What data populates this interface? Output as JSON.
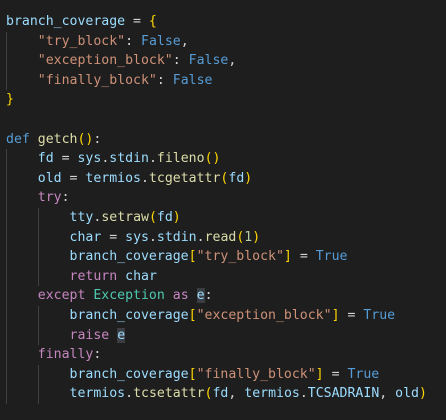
{
  "colors": {
    "background": "#1e1e1e",
    "variable": "#9cdcfe",
    "keyword": "#c586c0",
    "def_keyword": "#569cd6",
    "function": "#dcdcaa",
    "string": "#ce9178",
    "boolean": "#569cd6",
    "number": "#b5cea8",
    "class": "#4ec9b0",
    "bracket_level1": "#ffd700",
    "bracket_level2": "#da70d6"
  },
  "lines": [
    [
      [
        "branch_coverage",
        "var"
      ],
      [
        " = ",
        "op"
      ],
      [
        "{",
        "br1"
      ]
    ],
    [
      [
        "    ",
        "plain"
      ],
      [
        "\"try_block\"",
        "str"
      ],
      [
        ": ",
        "op"
      ],
      [
        "False",
        "bool"
      ],
      [
        ",",
        "op"
      ]
    ],
    [
      [
        "    ",
        "plain"
      ],
      [
        "\"exception_block\"",
        "str"
      ],
      [
        ": ",
        "op"
      ],
      [
        "False",
        "bool"
      ],
      [
        ",",
        "op"
      ]
    ],
    [
      [
        "    ",
        "plain"
      ],
      [
        "\"finally_block\"",
        "str"
      ],
      [
        ": ",
        "op"
      ],
      [
        "False",
        "bool"
      ]
    ],
    [
      [
        "}",
        "br1"
      ]
    ],
    [],
    [
      [
        "def",
        "def"
      ],
      [
        " ",
        "plain"
      ],
      [
        "getch",
        "fn"
      ],
      [
        "()",
        "br1"
      ],
      [
        ":",
        "op"
      ]
    ],
    [
      [
        "    ",
        "plain"
      ],
      [
        "fd",
        "var"
      ],
      [
        " = ",
        "op"
      ],
      [
        "sys",
        "var"
      ],
      [
        ".",
        "op"
      ],
      [
        "stdin",
        "var"
      ],
      [
        ".",
        "op"
      ],
      [
        "fileno",
        "fn"
      ],
      [
        "()",
        "br1"
      ]
    ],
    [
      [
        "    ",
        "plain"
      ],
      [
        "old",
        "var"
      ],
      [
        " = ",
        "op"
      ],
      [
        "termios",
        "var"
      ],
      [
        ".",
        "op"
      ],
      [
        "tcgetattr",
        "fn"
      ],
      [
        "(",
        "br1"
      ],
      [
        "fd",
        "var"
      ],
      [
        ")",
        "br1"
      ]
    ],
    [
      [
        "    ",
        "plain"
      ],
      [
        "try",
        "kw"
      ],
      [
        ":",
        "op"
      ]
    ],
    [
      [
        "        ",
        "plain"
      ],
      [
        "tty",
        "var"
      ],
      [
        ".",
        "op"
      ],
      [
        "setraw",
        "fn"
      ],
      [
        "(",
        "br1"
      ],
      [
        "fd",
        "var"
      ],
      [
        ")",
        "br1"
      ]
    ],
    [
      [
        "        ",
        "plain"
      ],
      [
        "char",
        "var"
      ],
      [
        " = ",
        "op"
      ],
      [
        "sys",
        "var"
      ],
      [
        ".",
        "op"
      ],
      [
        "stdin",
        "var"
      ],
      [
        ".",
        "op"
      ],
      [
        "read",
        "fn"
      ],
      [
        "(",
        "br1"
      ],
      [
        "1",
        "num"
      ],
      [
        ")",
        "br1"
      ]
    ],
    [
      [
        "        ",
        "plain"
      ],
      [
        "branch_coverage",
        "var"
      ],
      [
        "[",
        "br1"
      ],
      [
        "\"try_block\"",
        "str"
      ],
      [
        "]",
        "br1"
      ],
      [
        " = ",
        "op"
      ],
      [
        "True",
        "bool"
      ]
    ],
    [
      [
        "        ",
        "plain"
      ],
      [
        "return",
        "kw"
      ],
      [
        " ",
        "plain"
      ],
      [
        "char",
        "var"
      ]
    ],
    [
      [
        "    ",
        "plain"
      ],
      [
        "except",
        "kw"
      ],
      [
        " ",
        "plain"
      ],
      [
        "Exception",
        "cls"
      ],
      [
        " ",
        "plain"
      ],
      [
        "as",
        "kw"
      ],
      [
        " ",
        "plain"
      ],
      [
        "e",
        "var hl"
      ],
      [
        ":",
        "op"
      ]
    ],
    [
      [
        "        ",
        "plain"
      ],
      [
        "branch_coverage",
        "var"
      ],
      [
        "[",
        "br1"
      ],
      [
        "\"exception_block\"",
        "str"
      ],
      [
        "]",
        "br1"
      ],
      [
        " = ",
        "op"
      ],
      [
        "True",
        "bool"
      ]
    ],
    [
      [
        "        ",
        "plain"
      ],
      [
        "raise",
        "kw"
      ],
      [
        " ",
        "plain"
      ],
      [
        "e",
        "var hl"
      ]
    ],
    [
      [
        "    ",
        "plain"
      ],
      [
        "finally",
        "kw"
      ],
      [
        ":",
        "op"
      ]
    ],
    [
      [
        "        ",
        "plain"
      ],
      [
        "branch_coverage",
        "var"
      ],
      [
        "[",
        "br1"
      ],
      [
        "\"finally_block\"",
        "str"
      ],
      [
        "]",
        "br1"
      ],
      [
        " = ",
        "op"
      ],
      [
        "True",
        "bool"
      ]
    ],
    [
      [
        "        ",
        "plain"
      ],
      [
        "termios",
        "var"
      ],
      [
        ".",
        "op"
      ],
      [
        "tcsetattr",
        "fn"
      ],
      [
        "(",
        "br1"
      ],
      [
        "fd",
        "var"
      ],
      [
        ", ",
        "op"
      ],
      [
        "termios",
        "var"
      ],
      [
        ".",
        "op"
      ],
      [
        "TCSADRAIN",
        "var"
      ],
      [
        ", ",
        "op"
      ],
      [
        "old",
        "var"
      ],
      [
        ")",
        "br1"
      ]
    ]
  ]
}
